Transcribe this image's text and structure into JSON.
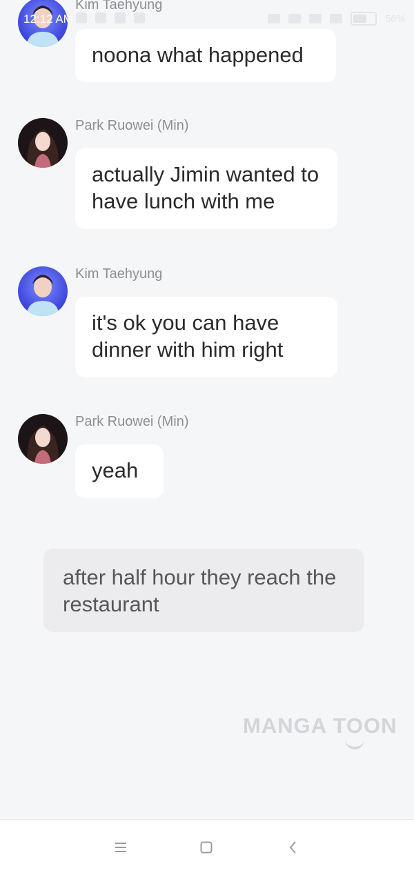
{
  "status_bar": {
    "time": "12:12 AM",
    "battery": "56%"
  },
  "messages": [
    {
      "sender": "Kim Taehyung",
      "text": "noona what happened",
      "avatar": "kim-taehyung-avatar"
    },
    {
      "sender": "Park Ruowei (Min)",
      "text": "actually Jimin wanted to have lunch with me",
      "avatar": "park-ruowei-avatar"
    },
    {
      "sender": "Kim Taehyung",
      "text": "it's ok you can have dinner with him right",
      "avatar": "kim-taehyung-avatar"
    },
    {
      "sender": "Park Ruowei (Min)",
      "text": "yeah",
      "avatar": "park-ruowei-avatar"
    }
  ],
  "narration": "after half hour they reach the restaurant",
  "watermark": "MANGA TOON",
  "nav": {
    "icons": [
      "menu-icon",
      "home-icon",
      "back-icon"
    ]
  },
  "colors": {
    "background": "#f5f6f8",
    "bubble": "#ffffff",
    "narration_bg": "#ececee",
    "sender_text": "#8d8e91"
  }
}
